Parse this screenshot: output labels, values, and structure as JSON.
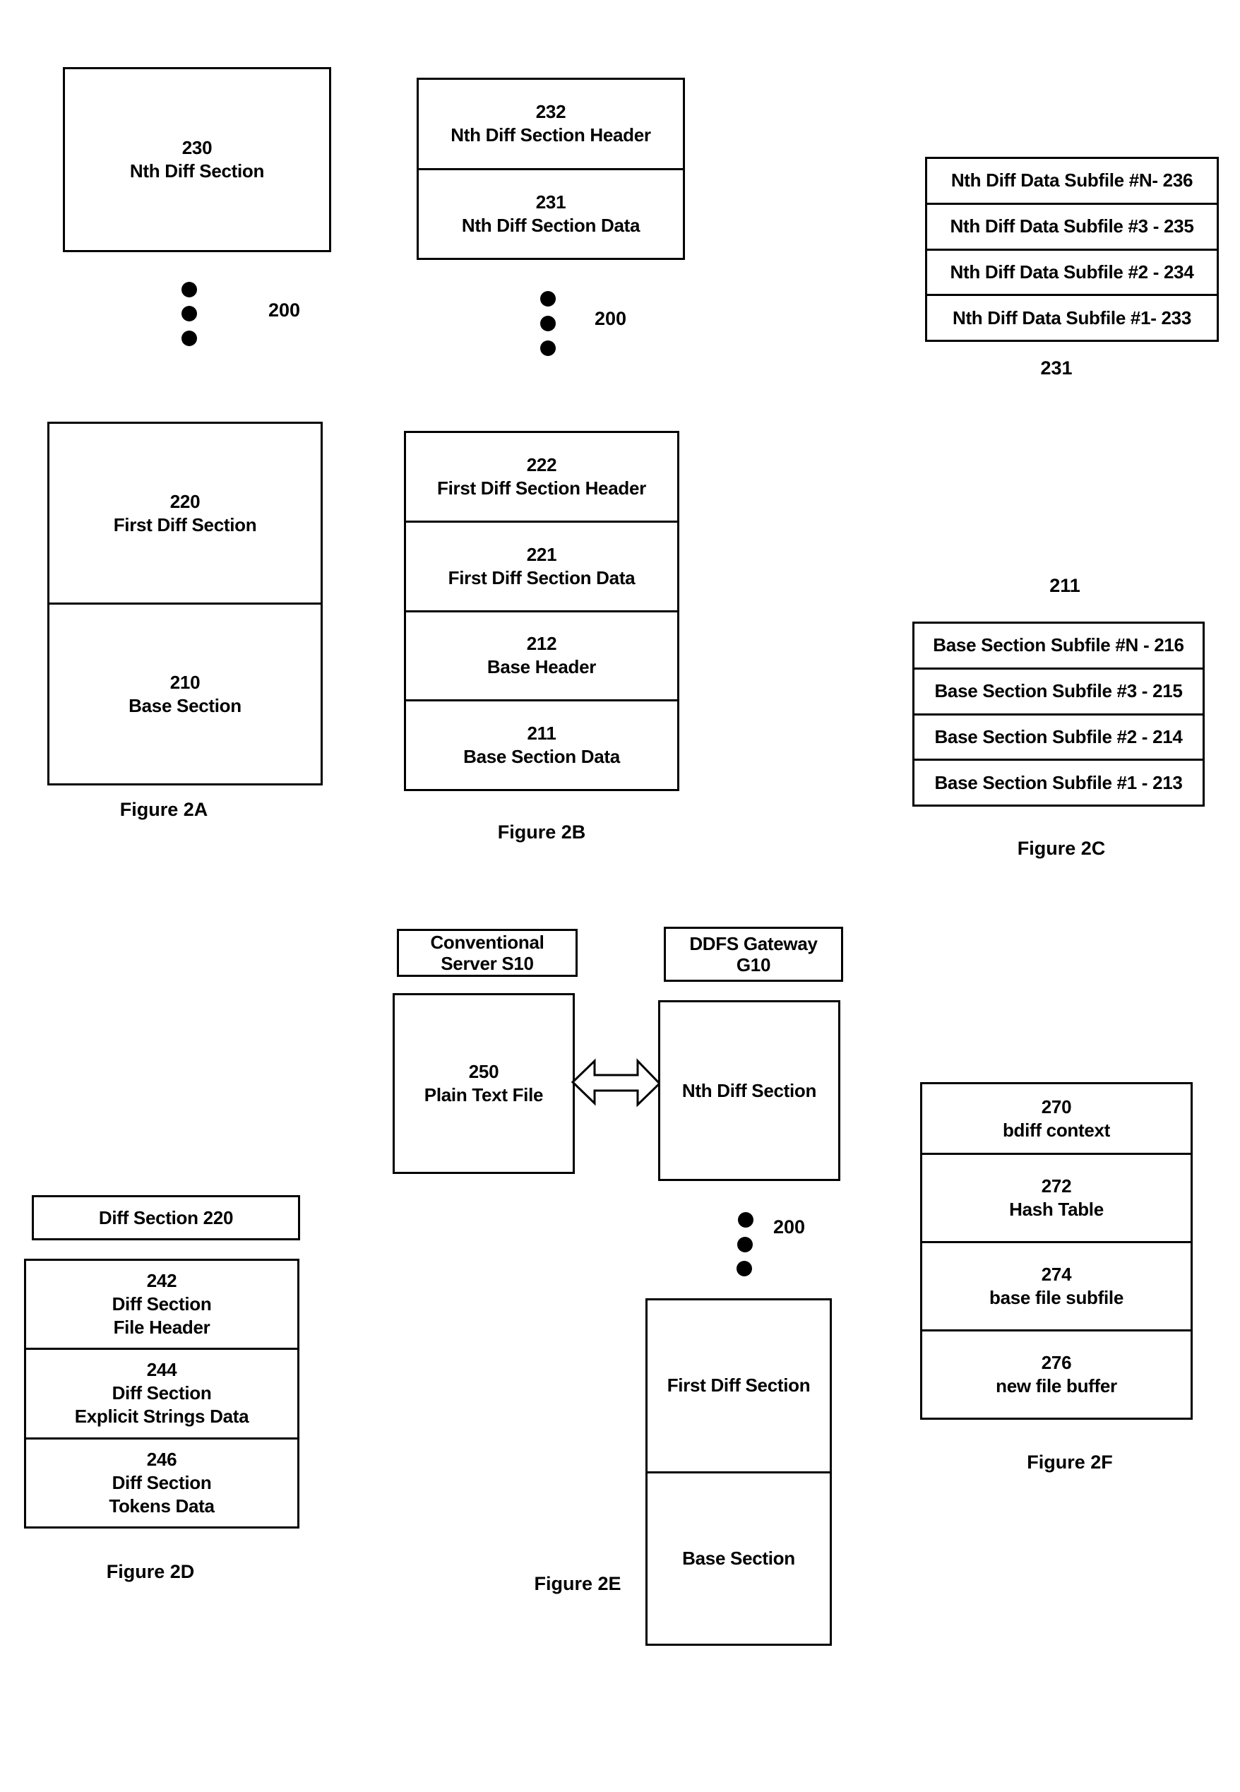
{
  "figures": {
    "fig2a": {
      "caption": "Figure 2A",
      "nth_section": {
        "number": "230",
        "label": "Nth Diff Section"
      },
      "ellipsis_label": "200",
      "stack": [
        {
          "number": "220",
          "label": "First Diff Section"
        },
        {
          "number": "210",
          "label": "Base Section"
        }
      ]
    },
    "fig2b": {
      "caption": "Figure 2B",
      "nth_stack": [
        {
          "number": "232",
          "label": "Nth Diff Section Header"
        },
        {
          "number": "231",
          "label": "Nth Diff Section Data"
        }
      ],
      "ellipsis_label": "200",
      "stack": [
        {
          "number": "222",
          "label": "First Diff Section Header"
        },
        {
          "number": "221",
          "label": "First Diff Section Data"
        },
        {
          "number": "212",
          "label": "Base Header"
        },
        {
          "number": "211",
          "label": "Base Section Data"
        }
      ]
    },
    "fig2c": {
      "caption": "Figure 2C",
      "nth_subfiles": [
        "Nth Diff Data Subfile #N- 236",
        "Nth Diff Data Subfile #3 - 235",
        "Nth Diff Data Subfile #2 - 234",
        "Nth Diff Data Subfile #1- 233"
      ],
      "nth_subfiles_label": "231",
      "base_subfiles_label": "211",
      "base_subfiles": [
        "Base Section Subfile #N - 216",
        "Base Section Subfile #3 - 215",
        "Base Section Subfile #2 - 214",
        "Base Section Subfile #1 - 213"
      ]
    },
    "fig2d": {
      "caption": "Figure 2D",
      "title": "Diff Section 220",
      "stack": [
        {
          "number": "242",
          "lines": [
            "Diff Section",
            "File Header"
          ]
        },
        {
          "number": "244",
          "lines": [
            "Diff Section",
            "Explicit Strings Data"
          ]
        },
        {
          "number": "246",
          "lines": [
            "Diff Section",
            "Tokens Data"
          ]
        }
      ]
    },
    "fig2e": {
      "caption": "Figure 2E",
      "server_label": [
        "Conventional",
        "Server S10"
      ],
      "gateway_label": [
        "DDFS Gateway",
        "G10"
      ],
      "plain_file": {
        "number": "250",
        "label": "Plain Text File"
      },
      "nth_section": "Nth Diff Section",
      "arrow_icon": "double-arrow",
      "ellipsis_label": "200",
      "stack": [
        "First Diff Section",
        "Base Section"
      ]
    },
    "fig2f": {
      "caption": "Figure 2F",
      "stack": [
        {
          "number": "270",
          "label": "bdiff context"
        },
        {
          "number": "272",
          "label": "Hash Table"
        },
        {
          "number": "274",
          "label": "base file subfile"
        },
        {
          "number": "276",
          "label": "new file buffer"
        }
      ]
    }
  }
}
